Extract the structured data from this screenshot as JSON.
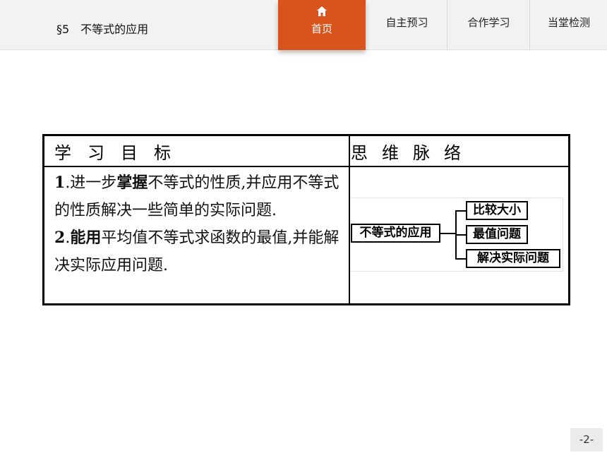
{
  "header": {
    "section_title": "§5　不等式的应用",
    "home_label": "首页",
    "tabs": [
      "自主预习",
      "合作学习",
      "当堂检测"
    ],
    "accent_color": "#d9541c"
  },
  "table": {
    "left_heading": "学习目标",
    "right_heading": "思维脉络",
    "goal1_num": "1",
    "goal1_pre": ".进一步",
    "goal1_key": "掌握",
    "goal1_rest": "不等式的性质,并应用不等式的性质解决一些简单的实际问题.",
    "goal2_num": "2",
    "goal2_pre": ".",
    "goal2_key": "能用",
    "goal2_rest": "平均值不等式求函数的最值,并能解决实际应用问题."
  },
  "mindmap": {
    "root": "不等式的应用",
    "branches": [
      "比较大小",
      "最值问题",
      "解决实际问题"
    ]
  },
  "footer": {
    "page_number": "-2-"
  }
}
